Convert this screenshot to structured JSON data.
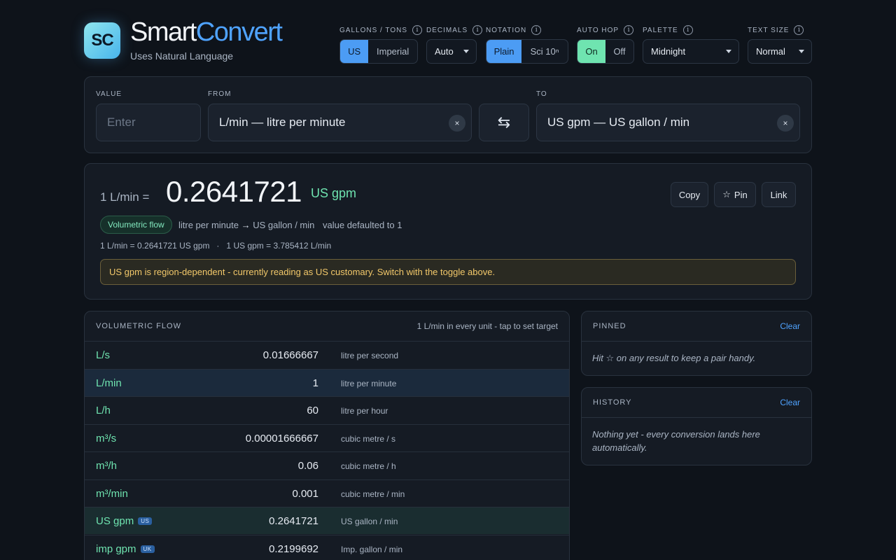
{
  "brand": {
    "badge": "SC",
    "title_part1": "Smart",
    "title_part2": "Convert",
    "subtitle": "Uses Natural Language"
  },
  "controls": {
    "gallons_tons": {
      "label": "GALLONS / TONS",
      "options": [
        "US",
        "Imperial"
      ],
      "selected": "US"
    },
    "decimals": {
      "label": "DECIMALS",
      "value": "Auto"
    },
    "notation": {
      "label": "NOTATION",
      "options": [
        "Plain",
        "Sci 10ⁿ"
      ],
      "selected": "Plain"
    },
    "auto_hop": {
      "label": "AUTO HOP",
      "options": [
        "On",
        "Off"
      ],
      "selected": "On"
    },
    "palette": {
      "label": "PALETTE",
      "value": "Midnight"
    },
    "text_size": {
      "label": "TEXT SIZE",
      "value": "Normal"
    },
    "info_icon": "i"
  },
  "converter": {
    "value_label": "VALUE",
    "value_placeholder": "Enter",
    "from_label": "FROM",
    "from_value": "L/min — litre per minute",
    "to_label": "TO",
    "to_value": "US gpm — US gallon / min",
    "clear_glyph": "×",
    "swap_glyph": "⇆"
  },
  "result": {
    "from_expr": "1 L/min  =",
    "value": "0.2641721",
    "unit": "US gpm",
    "actions": {
      "copy": "Copy",
      "pin_star": "☆",
      "pin": "Pin",
      "link": "Link"
    },
    "category": "Volumetric flow",
    "from_name": "litre per minute",
    "arrow": "→",
    "to_name": "US gallon / min",
    "note": "value defaulted to 1",
    "formula": "1 L/min = 0.2641721 US gpm   ·   1 US gpm = 3.785412 L/min",
    "warning": "US gpm is region-dependent - currently reading as US customary. Switch with the toggle above."
  },
  "table": {
    "title": "VOLUMETRIC FLOW",
    "note": "1 L/min in every unit - tap to set target",
    "rows": [
      {
        "unit": "L/s",
        "value": "0.01666667",
        "desc": "litre per second"
      },
      {
        "unit": "L/min",
        "value": "1",
        "desc": "litre per minute"
      },
      {
        "unit": "L/h",
        "value": "60",
        "desc": "litre per hour"
      },
      {
        "unit": "m³/s",
        "value": "0.00001666667",
        "desc": "cubic metre / s"
      },
      {
        "unit": "m³/h",
        "value": "0.06",
        "desc": "cubic metre / h"
      },
      {
        "unit": "m³/min",
        "value": "0.001",
        "desc": "cubic metre / min"
      },
      {
        "unit": "US gpm",
        "tag": "US",
        "value": "0.2641721",
        "desc": "US gallon / min"
      },
      {
        "unit": "imp gpm",
        "tag": "UK",
        "value": "0.2199692",
        "desc": "Imp. gallon / min"
      }
    ]
  },
  "pinned": {
    "title": "PINNED",
    "clear": "Clear",
    "empty": "Hit ☆ on any result to keep a pair handy."
  },
  "history": {
    "title": "HISTORY",
    "clear": "Clear",
    "empty": "Nothing yet - every conversion lands here automatically."
  },
  "colors": {
    "background": "#0e131a",
    "panel": "#151b24",
    "accent_blue": "#4c9cf4",
    "accent_green": "#6fe4b0",
    "warning_text": "#f2c86a"
  }
}
